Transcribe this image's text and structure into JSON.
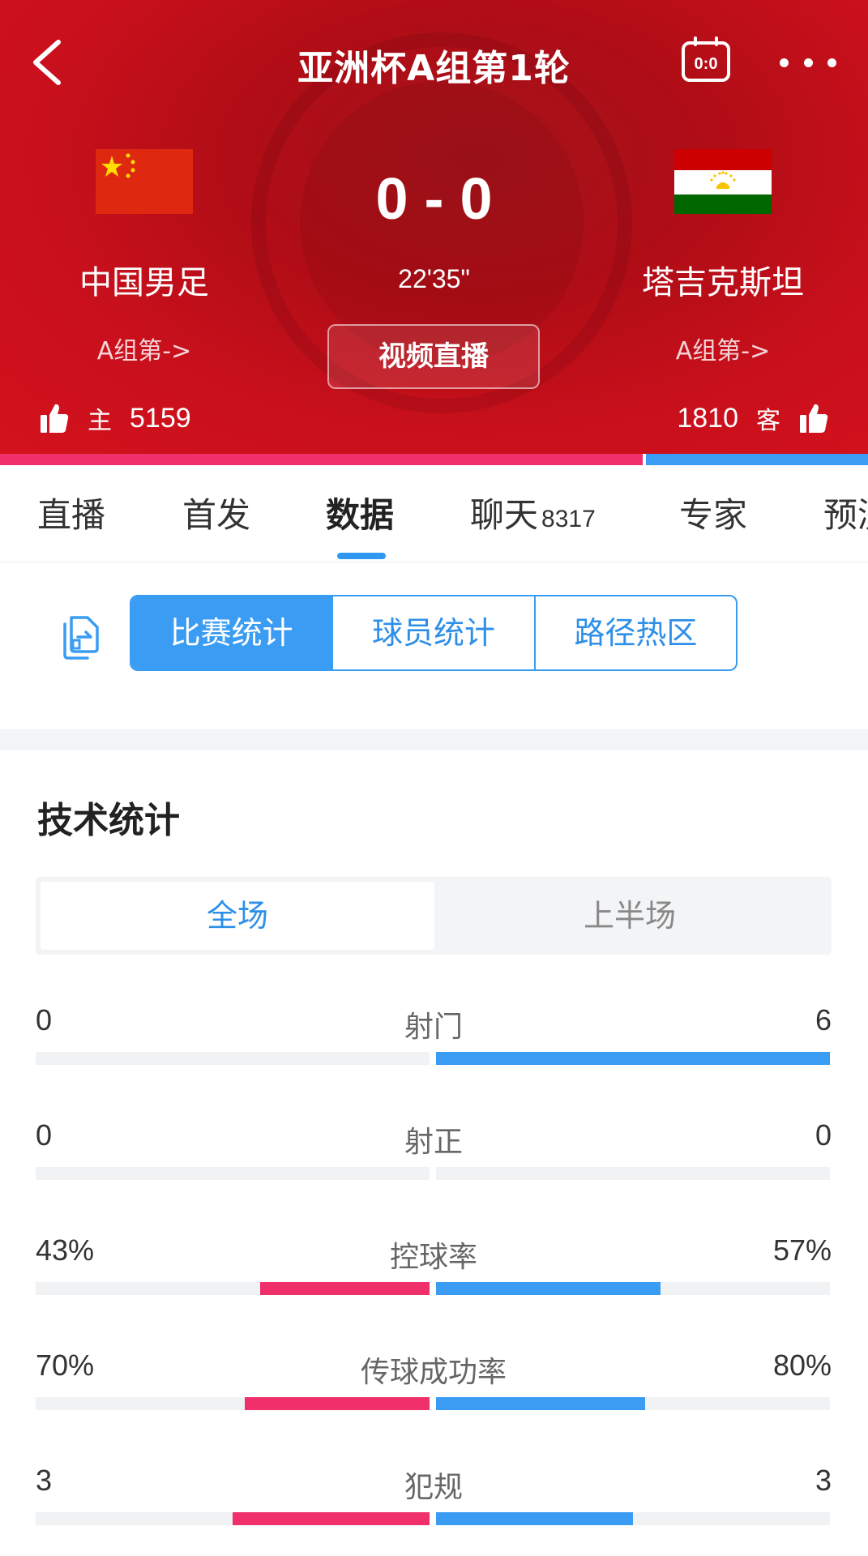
{
  "header": {
    "title": "亚洲杯A组第1轮",
    "score": "0 - 0",
    "time": "22'35\"",
    "video_label": "视频直播",
    "score_icon_text": "0:0",
    "home": {
      "name": "中国男足",
      "group": "A组第->",
      "likes": "5159",
      "tag": "主"
    },
    "away": {
      "name": "塔吉克斯坦",
      "group": "A组第->",
      "likes": "1810",
      "tag": "客"
    },
    "support_home_fraction": 0.74,
    "colors": {
      "home_accent": "#f0306a",
      "away_accent": "#3a9cf2",
      "header_red": "#c8101c"
    }
  },
  "tabs": [
    {
      "label": "直播"
    },
    {
      "label": "首发"
    },
    {
      "label": "数据",
      "active": true
    },
    {
      "label": "聊天",
      "count": "8317"
    },
    {
      "label": "专家"
    },
    {
      "label": "预测"
    }
  ],
  "segments": [
    "比赛统计",
    "球员统计",
    "路径热区"
  ],
  "stats_section": {
    "title": "技术统计",
    "periods": [
      "全场",
      "上半场"
    ],
    "rows": [
      {
        "label": "射门",
        "home": "0",
        "away": "6",
        "home_frac": 0.0,
        "away_frac": 1.0
      },
      {
        "label": "射正",
        "home": "0",
        "away": "0",
        "home_frac": 0.0,
        "away_frac": 0.0
      },
      {
        "label": "控球率",
        "home": "43%",
        "away": "57%",
        "home_frac": 0.43,
        "away_frac": 0.57
      },
      {
        "label": "传球成功率",
        "home": "70%",
        "away": "80%",
        "home_frac": 0.47,
        "away_frac": 0.53
      },
      {
        "label": "犯规",
        "home": "3",
        "away": "3",
        "home_frac": 0.5,
        "away_frac": 0.5
      }
    ]
  },
  "icons": [
    "back-icon",
    "scoreboard-icon",
    "more-icon",
    "thumbs-up-icon",
    "export-icon"
  ]
}
